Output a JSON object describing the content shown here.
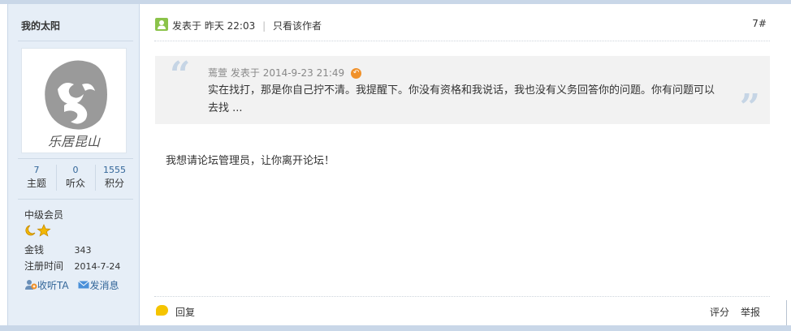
{
  "author": {
    "username": "我的太阳",
    "avatar_alt_text": "乐居昆山",
    "stats": [
      {
        "value": "7",
        "label": "主题"
      },
      {
        "value": "0",
        "label": "听众"
      },
      {
        "value": "1555",
        "label": "积分"
      }
    ],
    "group": "中级会员",
    "money_label": "金钱",
    "money_value": "343",
    "reg_label": "注册时间",
    "reg_value": "2014-7-24",
    "follow_label": "收听TA",
    "message_label": "发消息"
  },
  "post": {
    "posted_label": "发表于",
    "posted_time": "昨天 22:03",
    "only_author_label": "只看该作者",
    "floor": "7#",
    "quote": {
      "author": "蔫萱",
      "posted_label": "发表于",
      "time": "2014-9-23 21:49",
      "text": "实在找打，那是你自己拧不清。我提醒下。你没有资格和我说话，我也没有义务回答你的问题。你有问题可以去找 ..."
    },
    "message": "我想请论坛管理员，让你离开论坛！",
    "reply_label": "回复",
    "rate_label": "评分",
    "report_label": "举报"
  },
  "colors": {
    "sidebar_bg": "#e6eef7",
    "link_blue": "#336699",
    "quote_bg": "#f2f2f2"
  }
}
